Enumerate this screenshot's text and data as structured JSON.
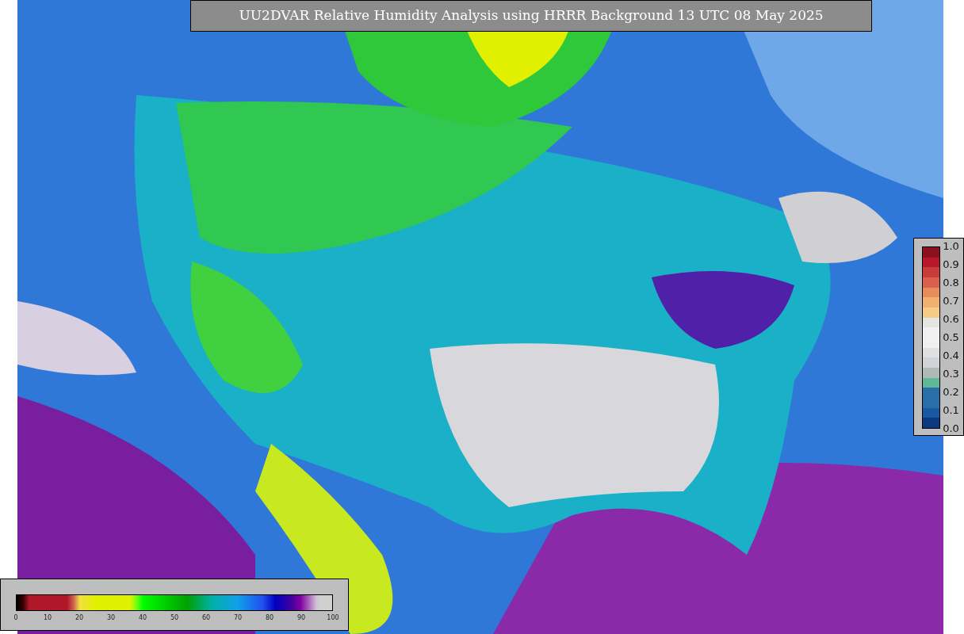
{
  "title": "UU2DVAR Relative Humidity Analysis using HRRR Background 13 UTC 08 May 2025",
  "humidity_colorbar": {
    "ticks": [
      "0",
      "10",
      "20",
      "30",
      "40",
      "50",
      "60",
      "70",
      "80",
      "90",
      "100"
    ]
  },
  "ratio_colorbar": {
    "ticks": [
      "1.0",
      "0.9",
      "0.8",
      "0.7",
      "0.6",
      "0.5",
      "0.4",
      "0.3",
      "0.2",
      "0.1",
      "0.0"
    ]
  }
}
